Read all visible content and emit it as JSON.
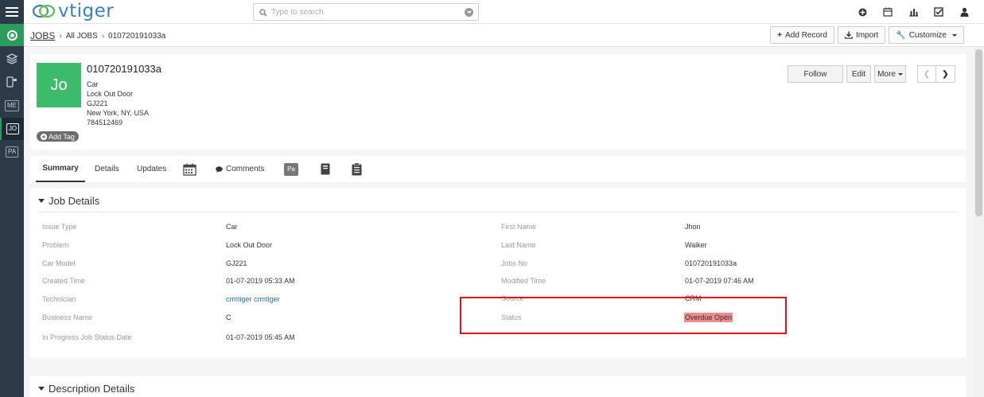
{
  "app": {
    "logo_text": "vtiger"
  },
  "search": {
    "placeholder": "Type to search"
  },
  "rail": {
    "items": [
      "ME",
      "JO",
      "PA"
    ]
  },
  "breadcrumb": {
    "module": "JOBS",
    "list": "All JOBS",
    "record": "010720191033a"
  },
  "actions": {
    "add_record": "Add Record",
    "import": "Import",
    "customize": "Customize"
  },
  "record": {
    "avatar": "Jo",
    "title": "010720191033a",
    "lines": [
      "Car",
      "Lock Out Door",
      "GJ221",
      "New York, NY, USA",
      "784512469"
    ],
    "add_tag": "Add Tag",
    "follow": "Follow",
    "edit": "Edit",
    "more": "More"
  },
  "tabs": {
    "summary": "Summary",
    "details": "Details",
    "updates": "Updates",
    "comments": "Comments",
    "pa": "Pa"
  },
  "job_details": {
    "title": "Job Details",
    "left": [
      {
        "label": "Issue Type",
        "value": "Car"
      },
      {
        "label": "Problem",
        "value": "Lock Out Door"
      },
      {
        "label": "Car Model",
        "value": "GJ221"
      },
      {
        "label": "Created Time",
        "value": "01-07-2019 05:33 AM"
      },
      {
        "label": "Technician",
        "value": "crmtiger crmtiger"
      },
      {
        "label": "Business Name",
        "value": "C"
      },
      {
        "label": "In Progress Job Status Date",
        "value": "01-07-2019 05:45 AM"
      }
    ],
    "right": [
      {
        "label": "First Name",
        "value": "Jhon"
      },
      {
        "label": "Last Name",
        "value": "Walker"
      },
      {
        "label": "Jobs No",
        "value": "010720191033a"
      },
      {
        "label": "Modified Time",
        "value": "01-07-2019 07:46 AM"
      },
      {
        "label": "Source",
        "value": "CRM"
      },
      {
        "label": "Status",
        "value": "Overdue Open"
      }
    ]
  },
  "description": {
    "title": "Description Details"
  },
  "colors": {
    "rail": "#2c3b47",
    "accent_green": "#2c9b5c",
    "avatar": "#3dbb6c",
    "status_badge": "#ef8c8c",
    "highlight": "#e0141a",
    "link": "#2a6ab4"
  }
}
